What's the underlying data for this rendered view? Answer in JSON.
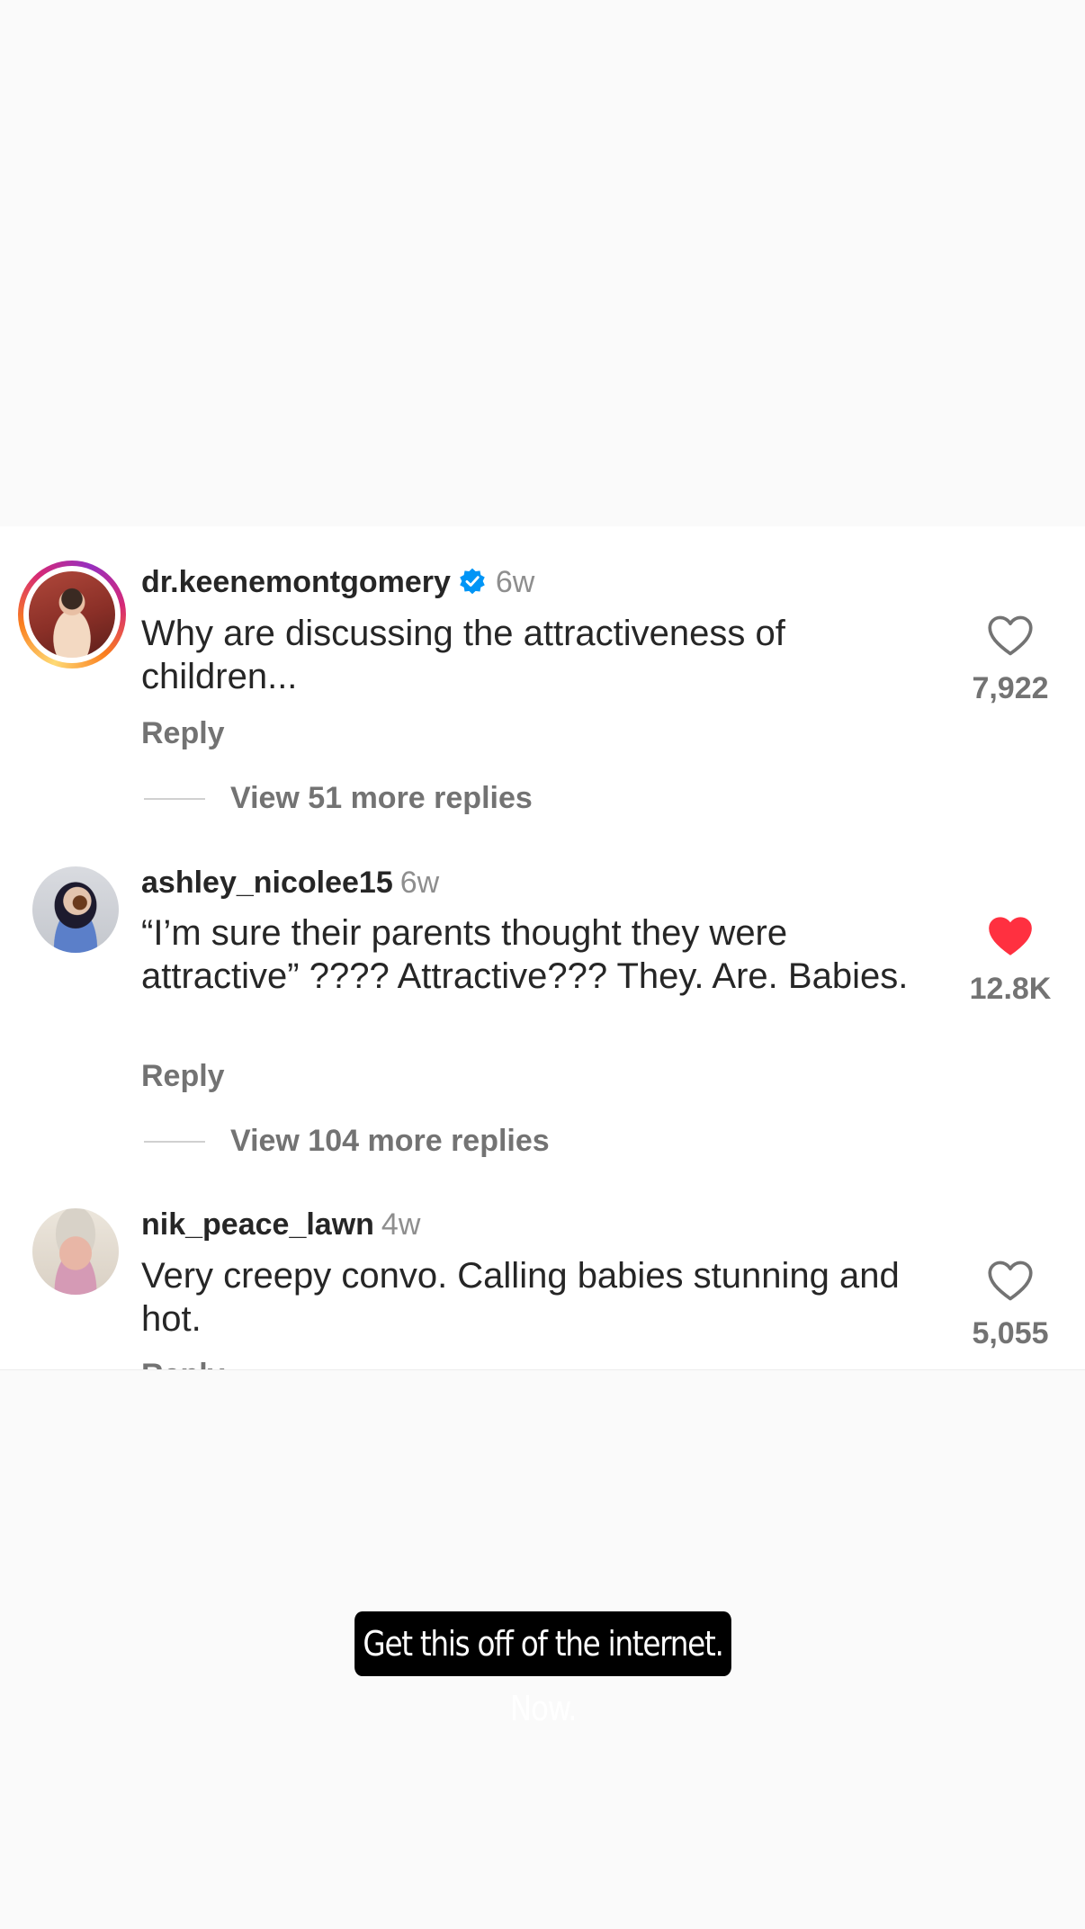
{
  "comments": [
    {
      "username": "dr.keenemontgomery",
      "verified": true,
      "time": "6w",
      "text": "Why are discussing the attractiveness of children...",
      "reply_label": "Reply",
      "view_replies_label": "View 51 more replies",
      "likes": "7,922",
      "liked": false,
      "avatar_icon": "profile-photo-story-ring"
    },
    {
      "username": "ashley_nicolee15",
      "verified": false,
      "time": "6w",
      "text": "“I’m sure their parents thought they were attractive” ???? Attractive??? They. Are. Babies.",
      "reply_label": "Reply",
      "view_replies_label": "View 104 more replies",
      "likes": "12.8K",
      "liked": true,
      "avatar_icon": "profile-photo"
    },
    {
      "username": "nik_peace_lawn",
      "verified": false,
      "time": "4w",
      "text": "Very creepy convo. Calling babies stunning and hot.",
      "reply_label": "Reply",
      "likes": "5,055",
      "liked": false,
      "avatar_icon": "profile-photo"
    }
  ],
  "caption": "Get this off of the internet. Now.",
  "colors": {
    "verified_blue": "#0095f6",
    "liked_red": "#ff3040",
    "text_primary": "#262626",
    "text_secondary": "#737373"
  }
}
